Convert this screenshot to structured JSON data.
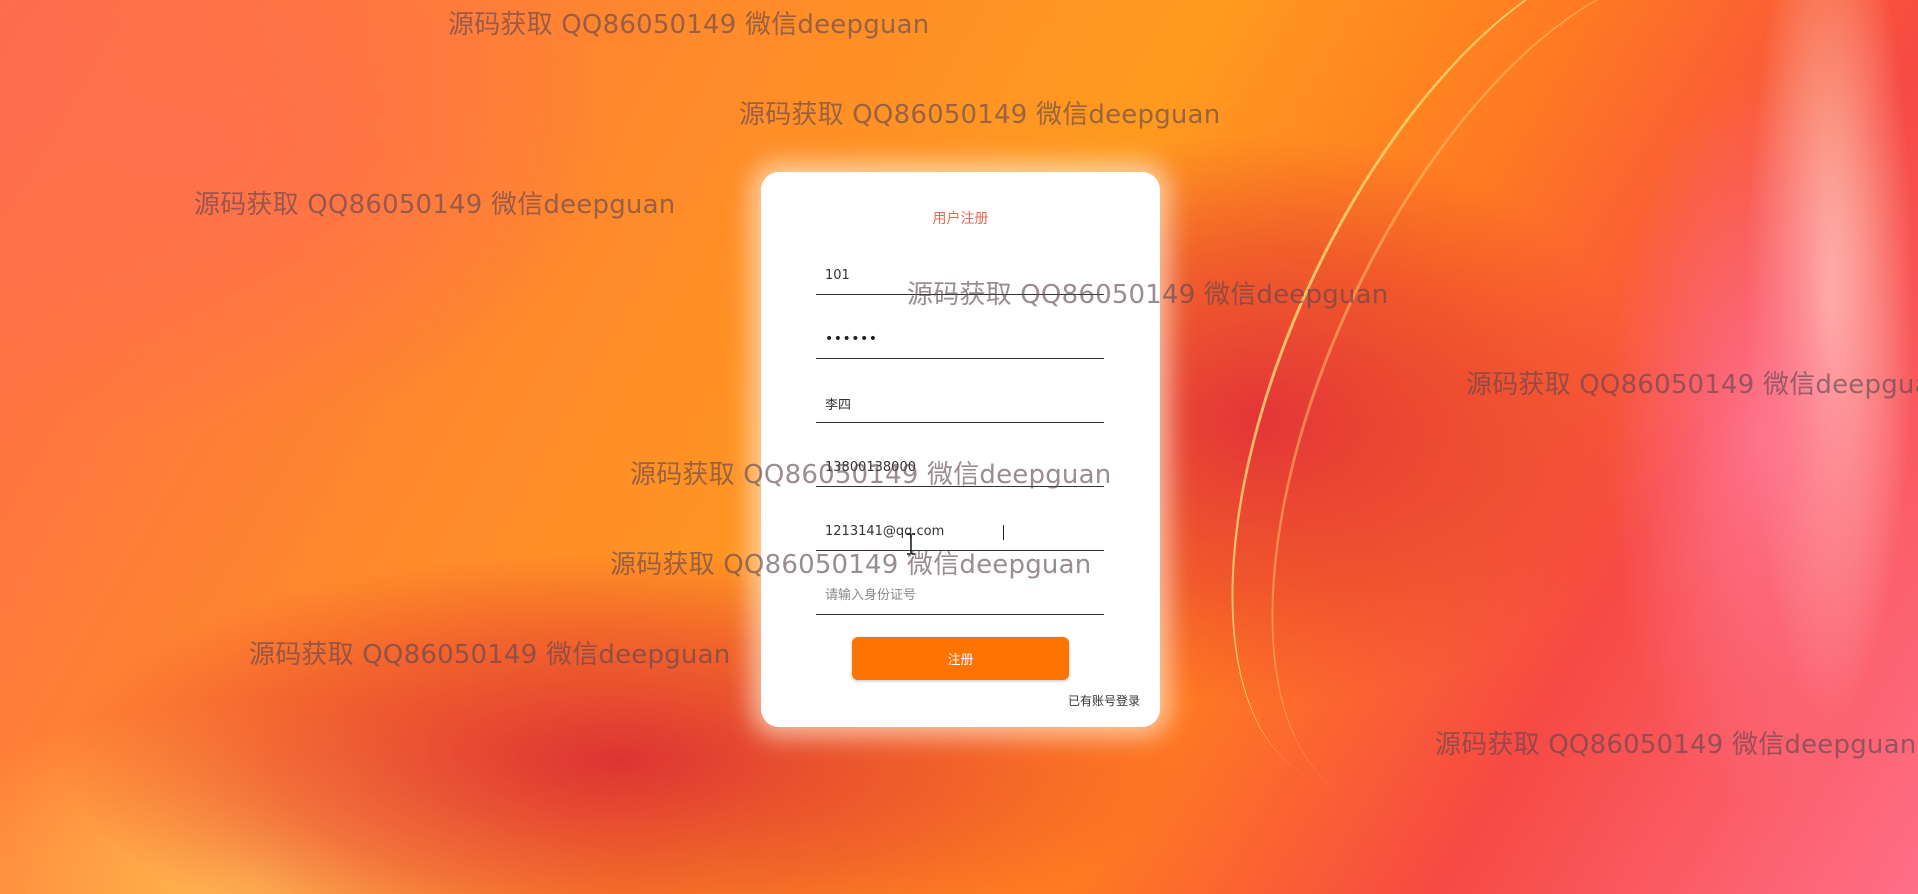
{
  "window": {
    "title": "用户注册"
  },
  "form": {
    "title": "用户注册",
    "fields": [
      {
        "name": "username",
        "value": "101",
        "placeholder": ""
      },
      {
        "name": "password",
        "value": "••••••",
        "placeholder": ""
      },
      {
        "name": "real-name",
        "value": "李四",
        "placeholder": ""
      },
      {
        "name": "phone",
        "value": "13800138000",
        "placeholder": ""
      },
      {
        "name": "email",
        "value": "1213141@qq.com",
        "placeholder": ""
      },
      {
        "name": "id-number",
        "value": "",
        "placeholder": "请输入身份证号"
      }
    ],
    "submit_label": "注册",
    "login_link": "已有账号登录"
  },
  "watermark": {
    "text": "源码获取 QQ86050149 微信deepguan",
    "color": "#5a4650"
  },
  "colors": {
    "accent": "#ff7300",
    "title": "#e26a55",
    "card": "#ffffff"
  }
}
